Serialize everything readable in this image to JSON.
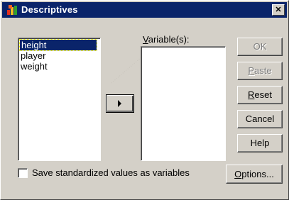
{
  "window": {
    "title": "Descriptives",
    "close_glyph": "✕",
    "title_icon": "spss-dialog-icon"
  },
  "source_list": {
    "items": [
      {
        "label": "height",
        "selected": true
      },
      {
        "label": "player",
        "selected": false
      },
      {
        "label": "weight",
        "selected": false
      }
    ]
  },
  "target": {
    "label": "Variable(s):",
    "items": []
  },
  "move_button": {
    "icon": "arrow-right-icon"
  },
  "buttons": {
    "ok": "OK",
    "paste": "Paste",
    "reset": "Reset",
    "cancel": "Cancel",
    "help": "Help",
    "options": "Options..."
  },
  "checkbox": {
    "label": "Save standardized values as variables",
    "checked": false
  },
  "colors": {
    "titlebar": "#0a246a",
    "face": "#d4d0c8",
    "selection": "#0a246a"
  }
}
